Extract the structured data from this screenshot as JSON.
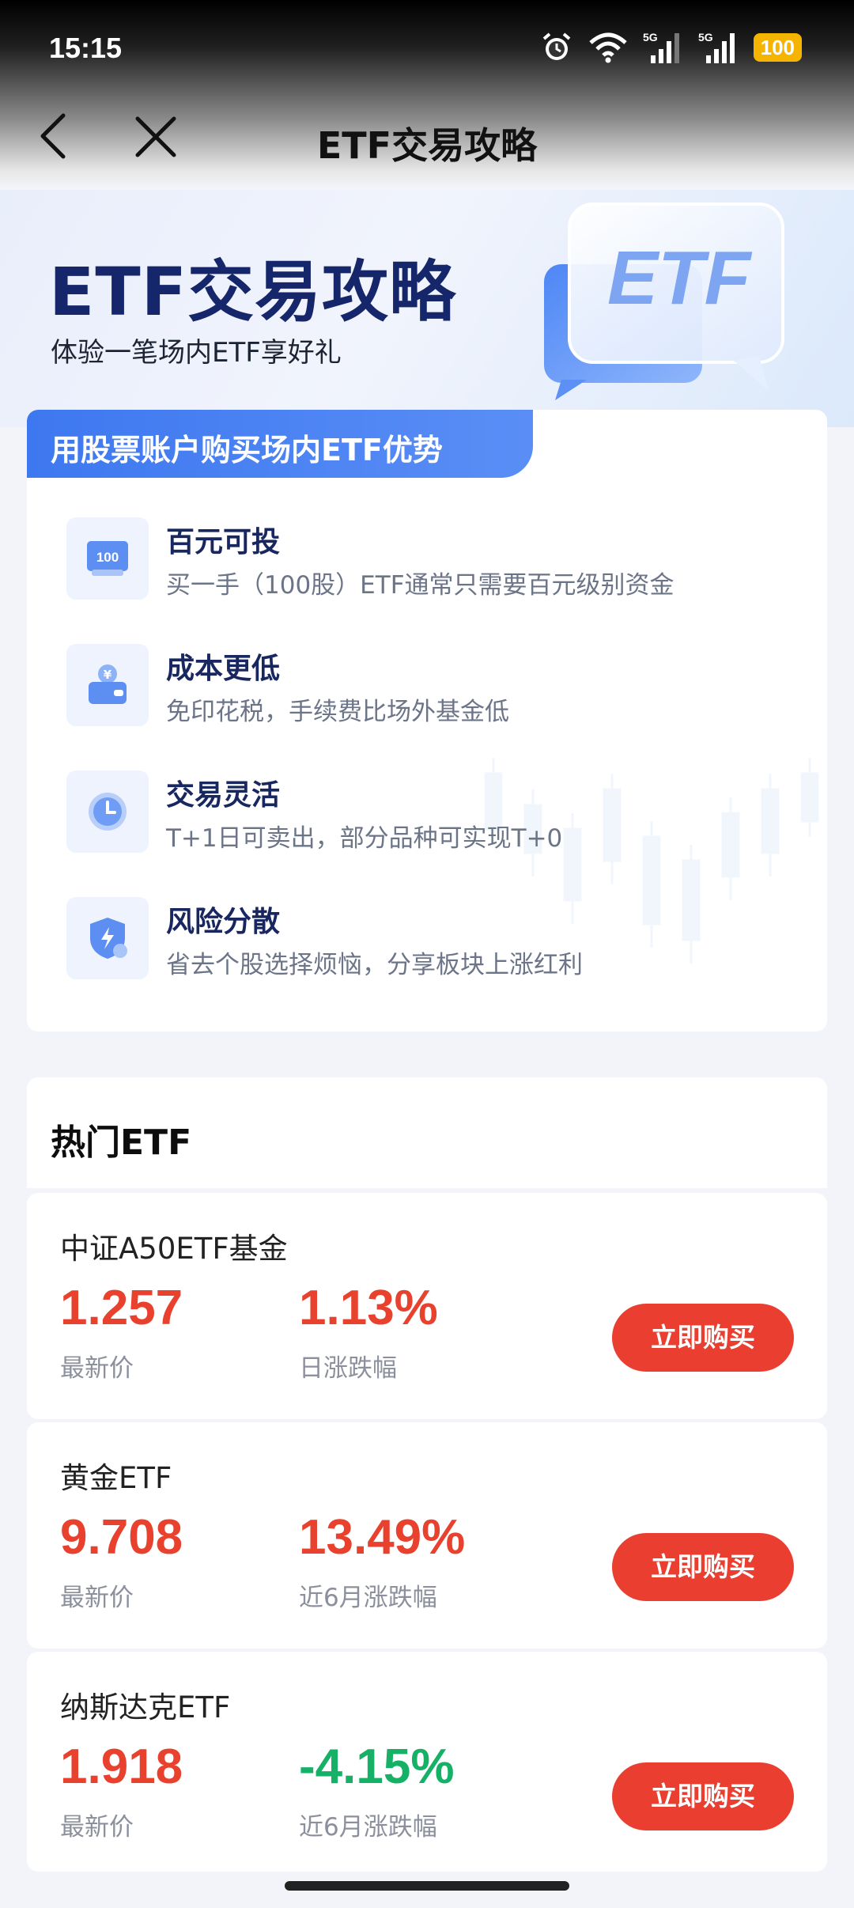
{
  "status_bar": {
    "time": "15:15",
    "battery": "100",
    "network_1": "5G",
    "network_2": "5G"
  },
  "nav": {
    "title": "ETF交易攻略"
  },
  "hero": {
    "title": "ETF交易攻略",
    "subtitle": "体验一笔场内ETF享好礼",
    "badge_text": "ETF"
  },
  "advantages": {
    "banner": "用股票账户购买场内ETF优势",
    "items": [
      {
        "icon": "hundred-note-icon",
        "icon_text": "100",
        "title": "百元可投",
        "desc": "买一手（100股）ETF通常只需要百元级别资金"
      },
      {
        "icon": "yen-wallet-icon",
        "title": "成本更低",
        "desc": "免印花税，手续费比场外基金低"
      },
      {
        "icon": "clock-icon",
        "title": "交易灵活",
        "desc": "T+1日可卖出，部分品种可实现T+0"
      },
      {
        "icon": "shield-icon",
        "title": "风险分散",
        "desc": "省去个股选择烦恼，分享板块上涨红利"
      }
    ]
  },
  "hot_etf": {
    "title": "热门ETF",
    "buy_label": "立即购买",
    "items": [
      {
        "name": "中证A50ETF基金",
        "price": "1.257",
        "price_label": "最新价",
        "change": "1.13%",
        "change_label": "日涨跌幅",
        "change_color": "#e8412e"
      },
      {
        "name": "黄金ETF",
        "price": "9.708",
        "price_label": "最新价",
        "change": "13.49%",
        "change_label": "近6月涨跌幅",
        "change_color": "#e8412e"
      },
      {
        "name": "纳斯达克ETF",
        "price": "1.918",
        "price_label": "最新价",
        "change": "-4.15%",
        "change_label": "近6月涨跌幅",
        "change_color": "#16b067"
      }
    ]
  },
  "colors": {
    "accent": "#3e78f0",
    "up": "#e8412e",
    "down": "#16b067",
    "buy_button": "#ea3f30"
  }
}
